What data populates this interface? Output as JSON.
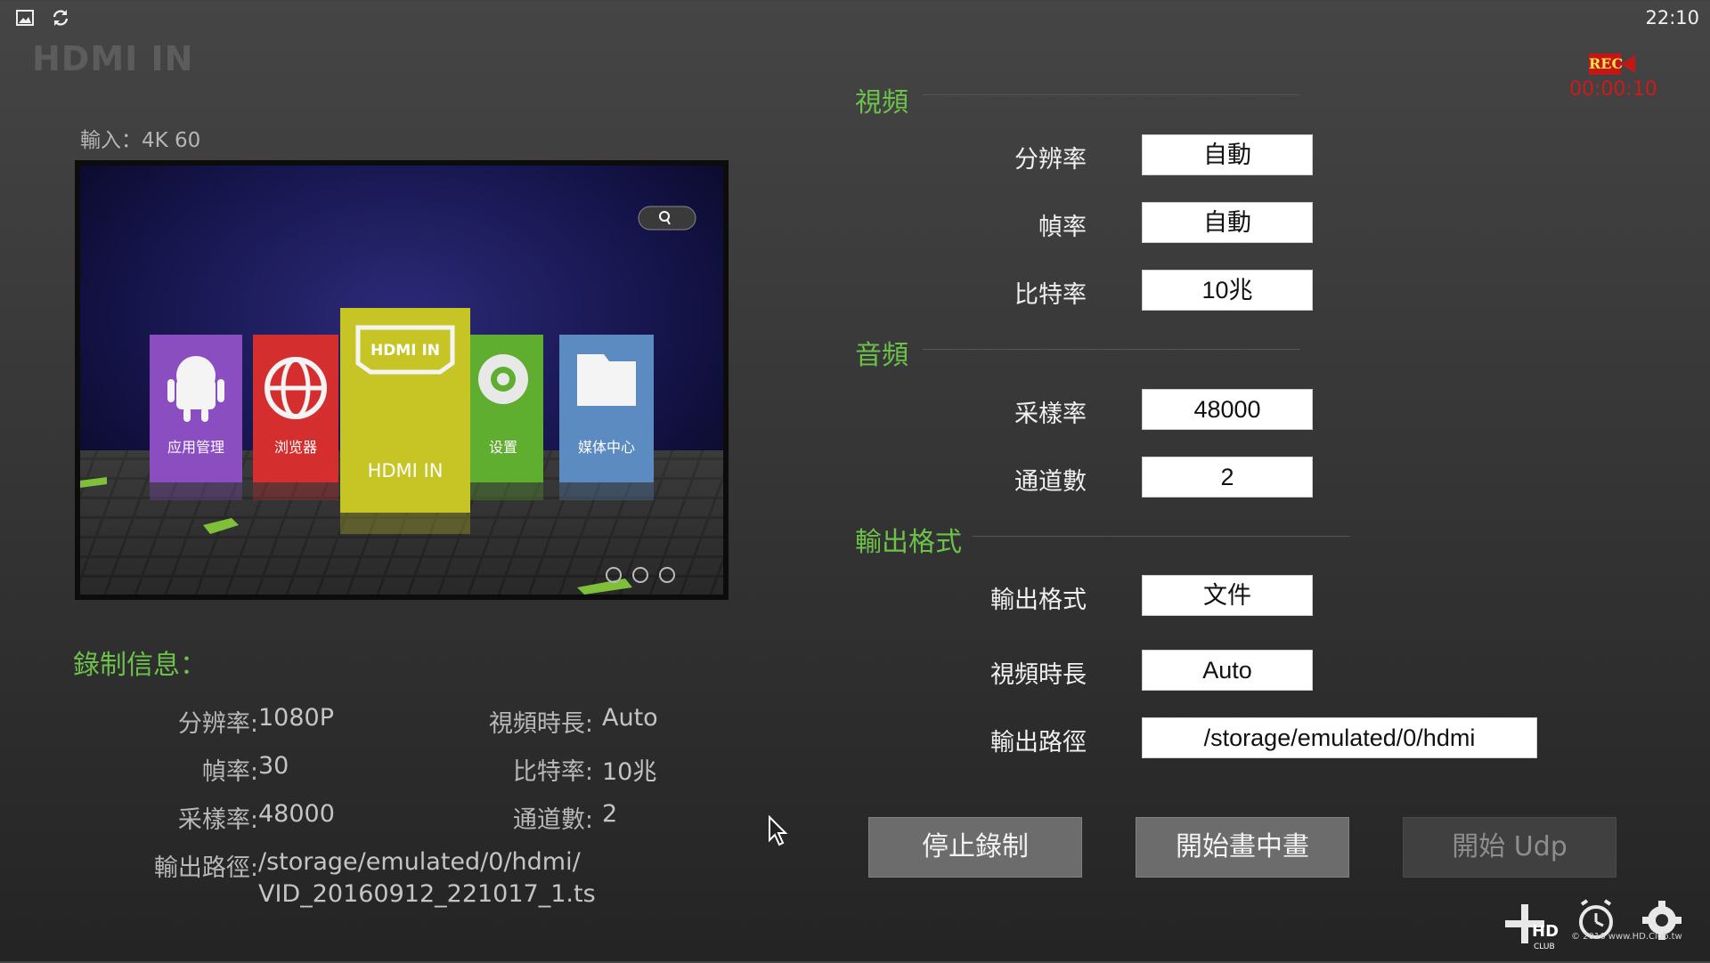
{
  "status_bar": {
    "time": "22:10",
    "icons": [
      "image-icon",
      "sync-icon"
    ]
  },
  "app": {
    "title": "HDMI IN"
  },
  "recording": {
    "badge": "REC",
    "elapsed": "00:00:10"
  },
  "input": {
    "label": "輸入：4K   60"
  },
  "preview": {
    "tiles": [
      {
        "label": "应用管理",
        "icon": "android-icon",
        "color": "#8a4ec0"
      },
      {
        "label": "浏览器",
        "icon": "globe-icon",
        "color": "#d42e2e"
      },
      {
        "label": "HDMI IN",
        "icon": "hdmi-icon",
        "color": "#c7c426"
      },
      {
        "label": "设置",
        "icon": "gear-icon",
        "color": "#5fae2f"
      },
      {
        "label": "媒体中心",
        "icon": "folder-icon",
        "color": "#5b8bc0"
      }
    ],
    "hdmi_logo_text": "HDMI IN"
  },
  "record_info": {
    "header": "錄制信息：",
    "rows": [
      {
        "label": "分辨率:",
        "value": "1080P"
      },
      {
        "label": "視頻時長:",
        "value": "Auto"
      },
      {
        "label": "幀率:",
        "value": "30"
      },
      {
        "label": "比特率:",
        "value": "10兆"
      },
      {
        "label": "采樣率:",
        "value": "48000"
      },
      {
        "label": "通道數:",
        "value": "2"
      },
      {
        "label": "輸出路徑:",
        "value": "/storage/emulated/0/hdmi/"
      },
      {
        "value": "VID_20160912_221017_1.ts"
      }
    ]
  },
  "settings": {
    "video": {
      "title": "視頻",
      "resolution": {
        "label": "分辨率",
        "value": "自動"
      },
      "framerate": {
        "label": "幀率",
        "value": "自動"
      },
      "bitrate": {
        "label": "比特率",
        "value": "10兆"
      }
    },
    "audio": {
      "title": "音頻",
      "samplerate": {
        "label": "采樣率",
        "value": "48000"
      },
      "channels": {
        "label": "通道數",
        "value": "2"
      }
    },
    "output": {
      "title": "輸出格式",
      "format": {
        "label": "輸出格式",
        "value": "文件"
      },
      "duration": {
        "label": "視頻時長",
        "value": "Auto"
      },
      "path": {
        "label": "輸出路徑",
        "value": "/storage/emulated/0/hdmi"
      }
    }
  },
  "buttons": {
    "stop_record": "停止錄制",
    "start_pip": "開始畫中畫",
    "start_udp": "開始 Udp"
  },
  "watermark": {
    "copyright": "© 2016  www.HD.Club.tw",
    "logo_text": "HD CLUB"
  },
  "colors": {
    "accent_green": "#6cc14a",
    "rec_red": "#d01a1a"
  }
}
